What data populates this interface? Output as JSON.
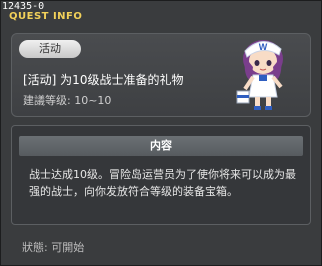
{
  "window": {
    "quest_id": "12435-0",
    "title": "QUEST INFO"
  },
  "quest": {
    "tag": "活动",
    "title": "[活动] 为10级战士准备的礼物",
    "level": "建議等级: 10~10"
  },
  "content": {
    "header": "内容",
    "description": "战士达成10级。冒险岛运营员为了使你将来可以成为最强的战士，向你发放符合等级的装备宝箱。"
  },
  "status": {
    "text": "狀態: 可開始"
  },
  "colors": {
    "title_accent": "#f2d15a",
    "background": "#3a3c3e",
    "panel": "#4a4c4f"
  }
}
